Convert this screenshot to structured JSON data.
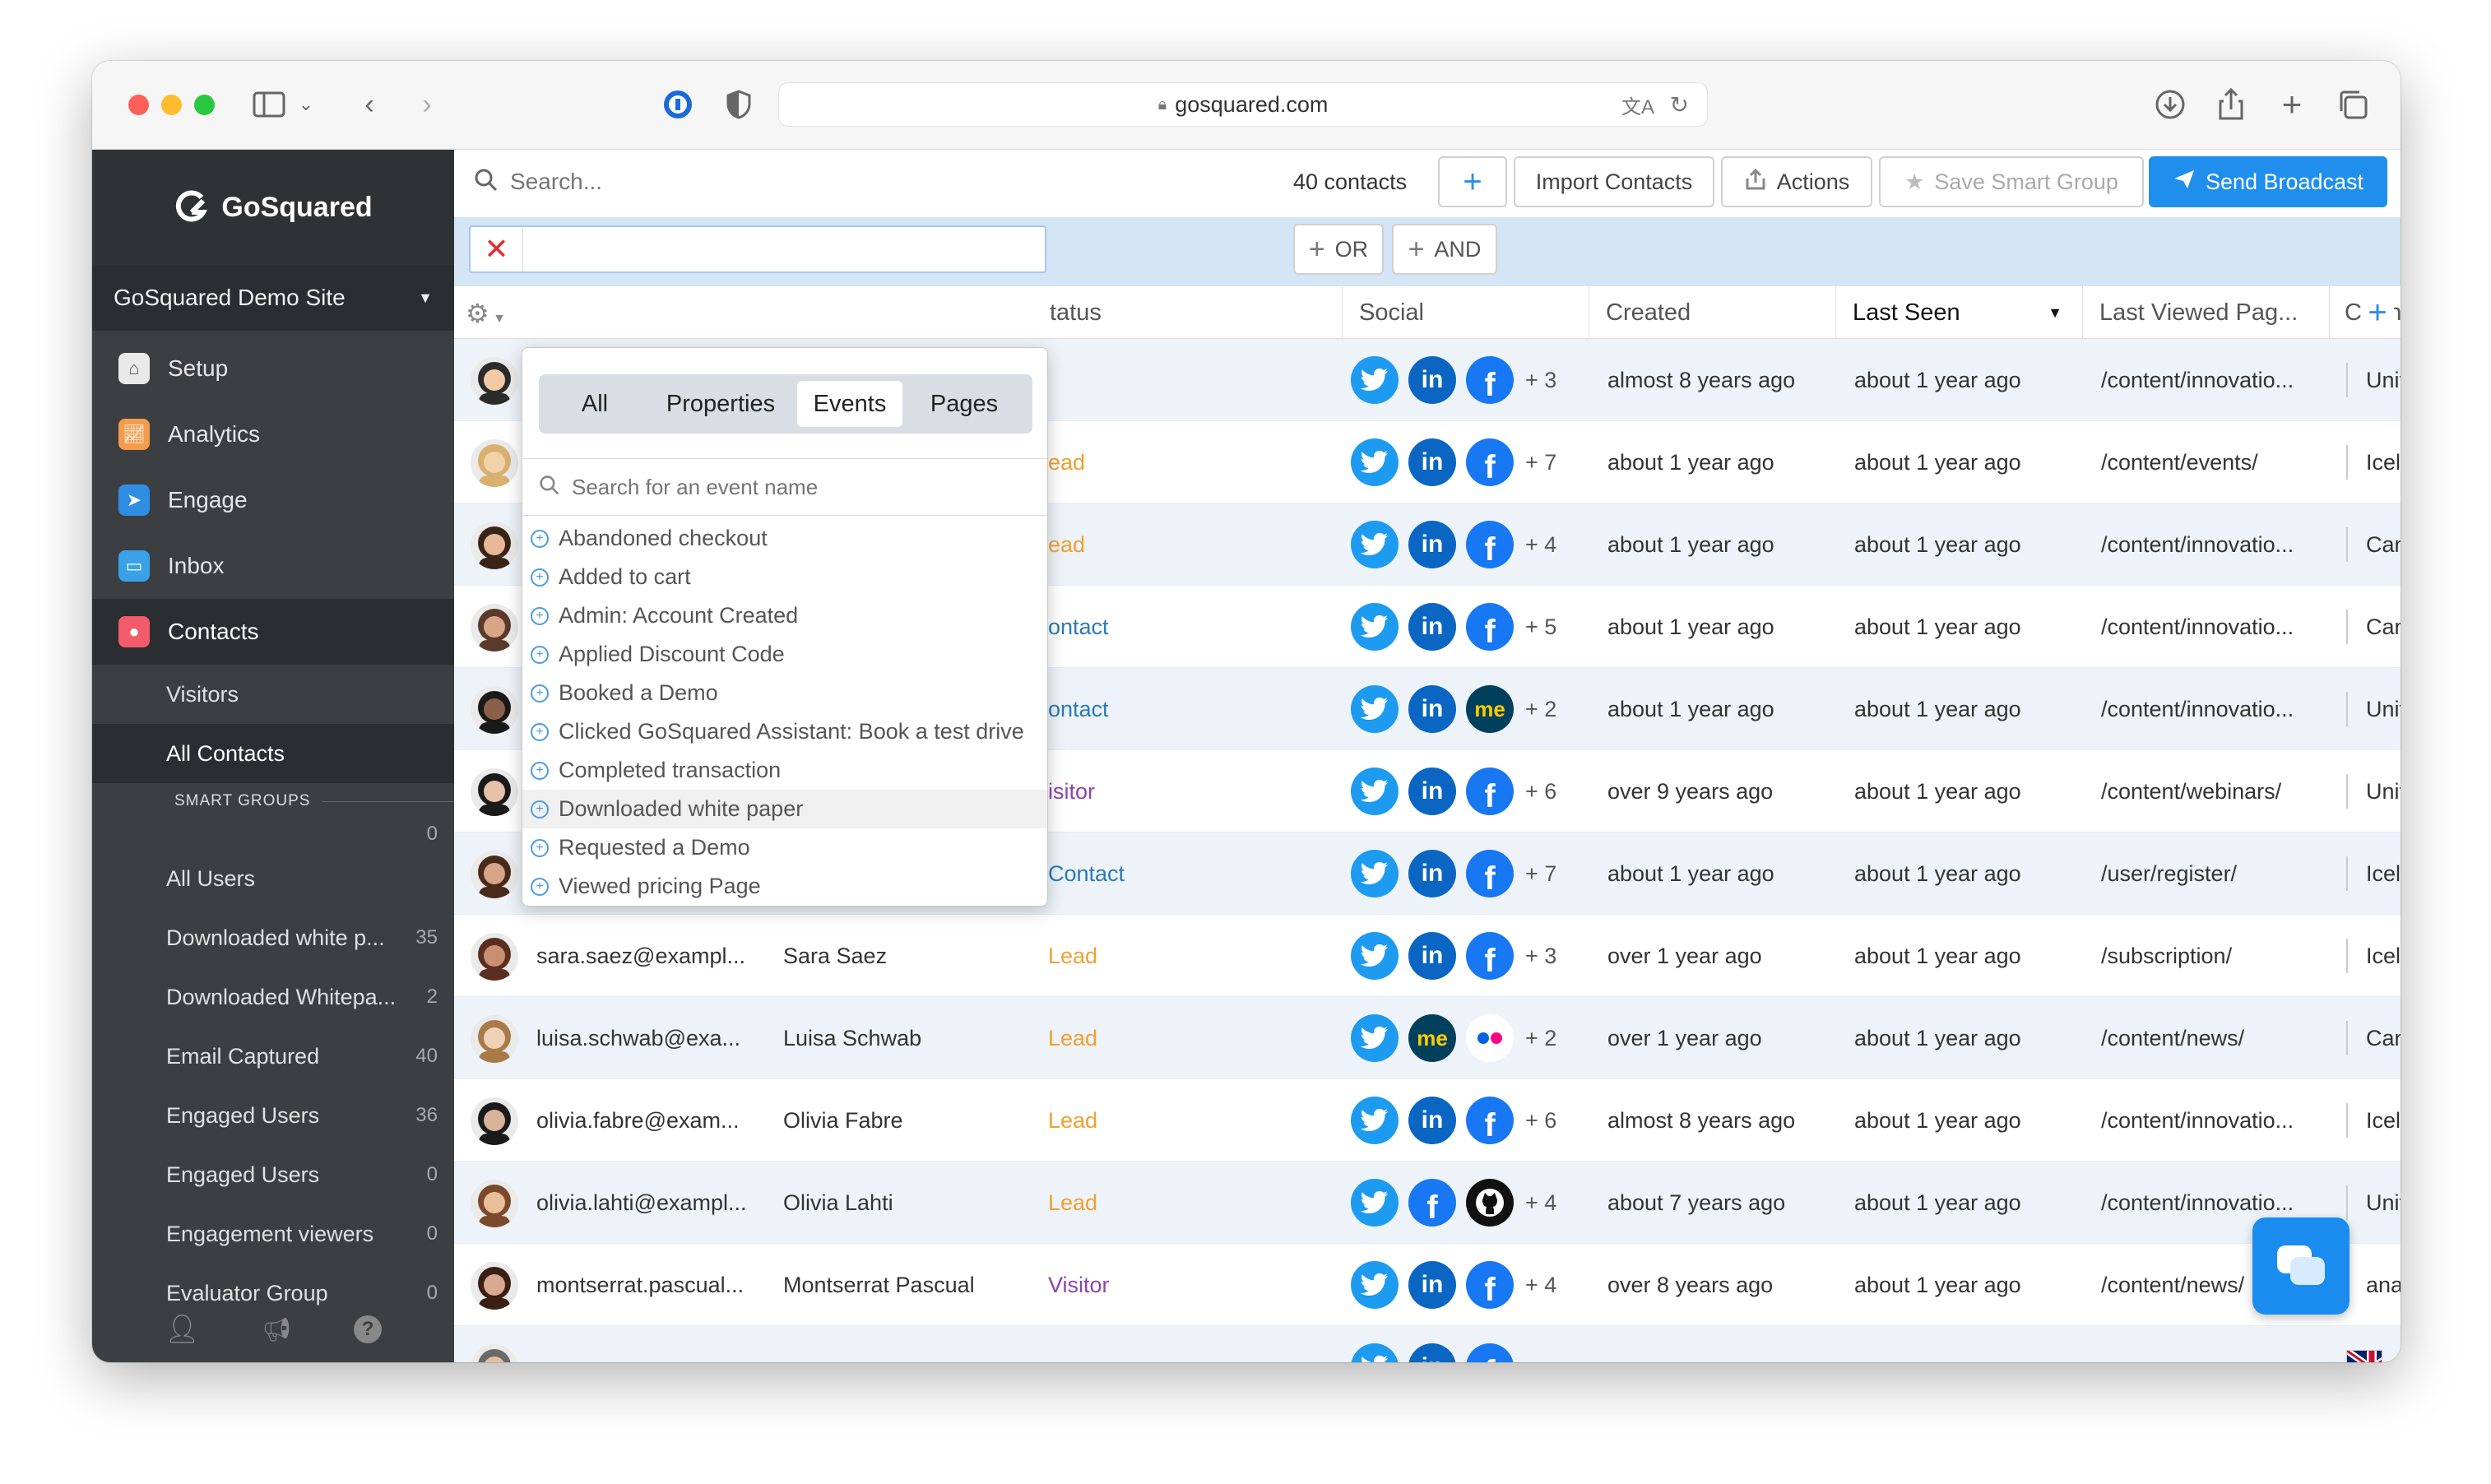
{
  "browser": {
    "url": "gosquared.com"
  },
  "sidebar": {
    "brand": "GoSquared",
    "site": "GoSquared Demo Site",
    "nav": [
      {
        "label": "Setup",
        "icon": "home-icon",
        "color": "#e9e9e9"
      },
      {
        "label": "Analytics",
        "icon": "chart-icon",
        "color": "#f39c4c"
      },
      {
        "label": "Engage",
        "icon": "send-icon",
        "color": "#2f8de4"
      },
      {
        "label": "Inbox",
        "icon": "inbox-icon",
        "color": "#3aa0e8"
      },
      {
        "label": "Contacts",
        "icon": "person-icon",
        "color": "#f25c6a"
      }
    ],
    "sub": [
      "Visitors",
      "All Contacts"
    ],
    "smart_groups_heading": "SMART GROUPS",
    "smart_groups_top_count": "0",
    "smart_groups": [
      {
        "label": "All Users",
        "count": ""
      },
      {
        "label": "Downloaded white p...",
        "count": "35"
      },
      {
        "label": "Downloaded Whitepa...",
        "count": "2"
      },
      {
        "label": "Email Captured",
        "count": "40"
      },
      {
        "label": "Engaged Users",
        "count": "36"
      },
      {
        "label": "Engaged Users",
        "count": "0"
      },
      {
        "label": "Engagement viewers",
        "count": "0"
      },
      {
        "label": "Evaluator Group",
        "count": "0"
      }
    ]
  },
  "toolbar": {
    "search_placeholder": "Search...",
    "contacts_count": "40 contacts",
    "add": "+",
    "import": "Import Contacts",
    "actions": "Actions",
    "save_group": "Save Smart Group",
    "broadcast": "Send Broadcast"
  },
  "filter": {
    "or": "OR",
    "and": "AND"
  },
  "columns": {
    "status": "tatus",
    "social": "Social",
    "created": "Created",
    "last_seen": "Last Seen",
    "last_viewed": "Last Viewed Pag...",
    "country": "Countr"
  },
  "dropdown": {
    "tabs": [
      "All",
      "Properties",
      "Events",
      "Pages"
    ],
    "active_tab": "Events",
    "search_placeholder": "Search for an event name",
    "events": [
      "Abandoned checkout",
      "Added to cart",
      "Admin: Account Created",
      "Applied Discount Code",
      "Booked a Demo",
      "Clicked GoSquared Assistant: Book a test drive",
      "Completed transaction",
      "Downloaded white paper",
      "Requested a Demo",
      "Viewed pricing Page"
    ]
  },
  "rows": [
    {
      "email": "",
      "name": "",
      "status": "",
      "status_color": "#2a7ab8",
      "social": [
        "twitter",
        "linkedin",
        "facebook"
      ],
      "more": "+ 3",
      "created": "almost 8 years ago",
      "last_seen": "about 1 year ago",
      "page": "/content/innovatio...",
      "country": "United",
      "flag": "us"
    },
    {
      "email": "",
      "name": "",
      "status": "ead",
      "status_color": "#f0a030",
      "social": [
        "twitter",
        "linkedin",
        "facebook"
      ],
      "more": "+ 7",
      "created": "about 1 year ago",
      "last_seen": "about 1 year ago",
      "page": "/content/events/",
      "country": "Iceland",
      "flag": "is"
    },
    {
      "email": "",
      "name": "",
      "status": "ead",
      "status_color": "#f0a030",
      "social": [
        "twitter",
        "linkedin",
        "facebook"
      ],
      "more": "+ 4",
      "created": "about 1 year ago",
      "last_seen": "about 1 year ago",
      "page": "/content/innovatio...",
      "country": "Canada",
      "flag": "ca"
    },
    {
      "email": "",
      "name": "",
      "status": "ontact",
      "status_color": "#2a7ab8",
      "social": [
        "twitter",
        "linkedin",
        "facebook"
      ],
      "more": "+ 5",
      "created": "about 1 year ago",
      "last_seen": "about 1 year ago",
      "page": "/content/innovatio...",
      "country": "Canada",
      "flag": "ca"
    },
    {
      "email": "",
      "name": "",
      "status": "ontact",
      "status_color": "#2a7ab8",
      "social": [
        "twitter",
        "linkedin",
        "aboutme"
      ],
      "more": "+ 2",
      "created": "about 1 year ago",
      "last_seen": "about 1 year ago",
      "page": "/content/innovatio...",
      "country": "United",
      "flag": "uk"
    },
    {
      "email": "",
      "name": "",
      "status": "isitor",
      "status_color": "#8e44ad",
      "social": [
        "twitter",
        "linkedin",
        "facebook"
      ],
      "more": "+ 6",
      "created": "over 9 years ago",
      "last_seen": "about 1 year ago",
      "page": "/content/webinars/",
      "country": "United",
      "flag": "us"
    },
    {
      "email": "jennifer.bishop@ex...",
      "name": "Jennifer Bishop",
      "status": "Contact",
      "status_color": "#2a7ab8",
      "social": [
        "twitter",
        "linkedin",
        "facebook"
      ],
      "more": "+ 7",
      "created": "about 1 year ago",
      "last_seen": "about 1 year ago",
      "page": "/user/register/",
      "country": "Iceland",
      "flag": "is"
    },
    {
      "email": "sara.saez@exampl...",
      "name": "Sara Saez",
      "status": "Lead",
      "status_color": "#f0a030",
      "social": [
        "twitter",
        "linkedin",
        "facebook"
      ],
      "more": "+ 3",
      "created": "over 1 year ago",
      "last_seen": "about 1 year ago",
      "page": "/subscription/",
      "country": "Iceland",
      "flag": "is"
    },
    {
      "email": "luisa.schwab@exa...",
      "name": "Luisa Schwab",
      "status": "Lead",
      "status_color": "#f0a030",
      "social": [
        "twitter",
        "aboutme",
        "flickr"
      ],
      "more": "+ 2",
      "created": "over 1 year ago",
      "last_seen": "about 1 year ago",
      "page": "/content/news/",
      "country": "Canada",
      "flag": "ca"
    },
    {
      "email": "olivia.fabre@exam...",
      "name": "Olivia Fabre",
      "status": "Lead",
      "status_color": "#f0a030",
      "social": [
        "twitter",
        "linkedin",
        "facebook"
      ],
      "more": "+ 6",
      "created": "almost 8 years ago",
      "last_seen": "about 1 year ago",
      "page": "/content/innovatio...",
      "country": "Iceland",
      "flag": "is"
    },
    {
      "email": "olivia.lahti@exampl...",
      "name": "Olivia Lahti",
      "status": "Lead",
      "status_color": "#f0a030",
      "social": [
        "twitter",
        "facebook",
        "github"
      ],
      "more": "+ 4",
      "created": "about 7 years ago",
      "last_seen": "about 1 year ago",
      "page": "/content/innovatio...",
      "country": "United",
      "flag": "us"
    },
    {
      "email": "montserrat.pascual...",
      "name": "Montserrat Pascual",
      "status": "Visitor",
      "status_color": "#8e44ad",
      "social": [
        "twitter",
        "linkedin",
        "facebook"
      ],
      "more": "+ 4",
      "created": "over 8 years ago",
      "last_seen": "about 1 year ago",
      "page": "/content/news/",
      "country": "anada",
      "flag": "ca"
    },
    {
      "email": "",
      "name": "",
      "status": "",
      "status_color": "#2a7ab8",
      "social": [
        "twitter",
        "linkedin",
        "facebook"
      ],
      "more": "",
      "created": "",
      "last_seen": "",
      "page": "",
      "country": "",
      "flag": "uk"
    }
  ]
}
